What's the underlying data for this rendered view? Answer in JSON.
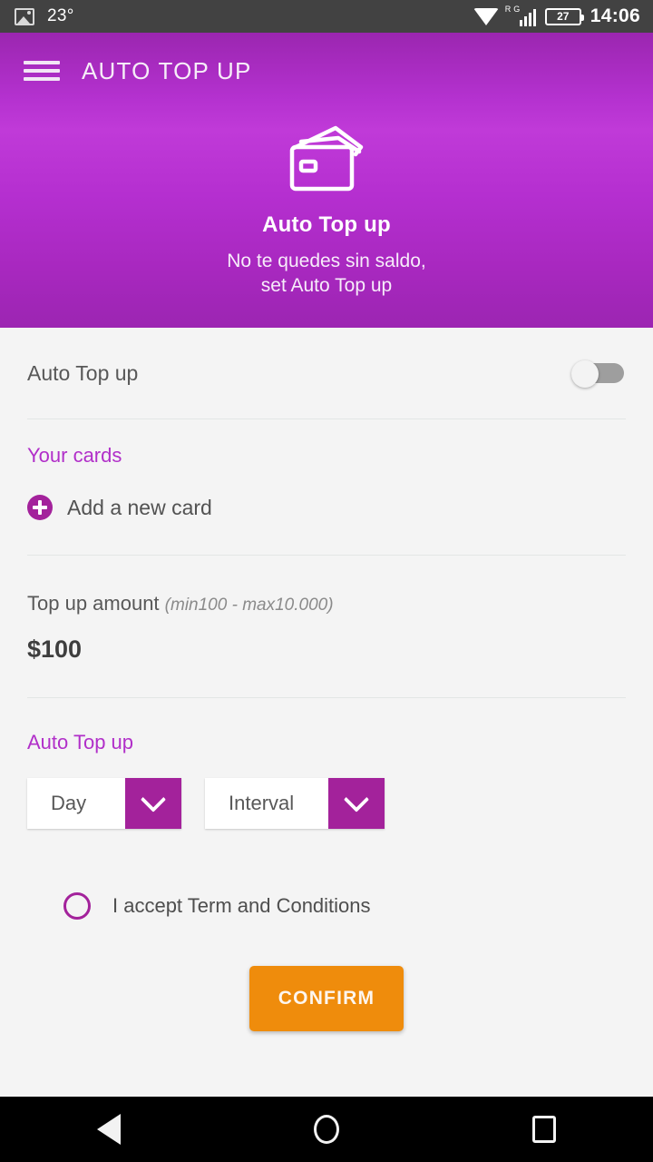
{
  "status_bar": {
    "photo_icon": "photo-icon",
    "temperature": "23°",
    "wifi_icon": "wifi-icon",
    "roaming_label": "R",
    "network_type": "G",
    "battery_level": "27",
    "time": "14:06"
  },
  "app_bar": {
    "menu_icon": "hamburger-menu-icon",
    "title": "AUTO TOP UP"
  },
  "hero": {
    "icon": "credit-cards-icon",
    "title": "Auto Top up",
    "subtitle_line1": "No te quedes sin saldo,",
    "subtitle_line2": "set Auto Top up"
  },
  "toggle_row": {
    "label": "Auto Top up",
    "state": "off"
  },
  "cards_section": {
    "title": "Your cards",
    "add_card_icon": "plus-circle-icon",
    "add_card_label": "Add a new card"
  },
  "amount_section": {
    "label": "Top up amount",
    "hint": "(min100 - max10.000)",
    "value": "$100"
  },
  "schedule_section": {
    "title": "Auto Top up",
    "day_select": {
      "value": "Day",
      "chevron_icon": "chevron-down-icon"
    },
    "interval_select": {
      "value": "Interval",
      "chevron_icon": "chevron-down-icon"
    }
  },
  "terms": {
    "label": "I accept Term and Conditions",
    "checked": false
  },
  "confirm_button": {
    "label": "CONFIRM"
  },
  "nav_bar": {
    "back_icon": "back-triangle-icon",
    "home_icon": "home-circle-icon",
    "recents_icon": "recents-square-icon"
  },
  "colors": {
    "brand_purple": "#a3229b",
    "hero_gradient_top": "#9b26b0",
    "hero_gradient_mid": "#c03ad8",
    "accent_orange": "#ef8c0c",
    "section_title": "#b12fc9",
    "status_bar_bg": "#424242",
    "content_bg": "#f4f4f4"
  }
}
